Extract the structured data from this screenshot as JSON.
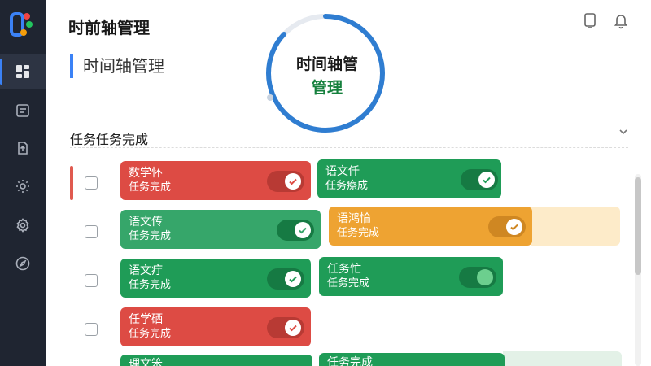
{
  "header": {
    "app_title": "时前轴管理",
    "subtitle": "时间轴管理"
  },
  "progress_ring": {
    "line1": "时间轴管",
    "line2": "管理",
    "progress": 0.87
  },
  "section": {
    "title": "任务任务完成"
  },
  "sidebar": {
    "items": [
      {
        "icon": "dashboard-icon",
        "active": true
      },
      {
        "icon": "document-icon",
        "active": false
      },
      {
        "icon": "file-upload-icon",
        "active": false
      },
      {
        "icon": "settings-icon",
        "active": false
      },
      {
        "icon": "gear-icon",
        "active": false
      },
      {
        "icon": "compass-icon",
        "active": false
      }
    ]
  },
  "top_icons": [
    "tablet-icon",
    "bell-icon"
  ],
  "cards": [
    {
      "title": "数学怀",
      "status": "任务完成",
      "color": "red",
      "toggle": "check"
    },
    {
      "title": "语文仟",
      "status": "任务瘵成",
      "color": "green",
      "toggle": "check"
    },
    {
      "title": "语文传",
      "status": "任务完成",
      "color": "lgreen",
      "toggle": "check"
    },
    {
      "title": "语鸿惀",
      "status": "任务完成",
      "color": "orange",
      "toggle": "check"
    },
    {
      "title": "语文疔",
      "status": "任务完成",
      "color": "green",
      "toggle": "check"
    },
    {
      "title": "任务忙",
      "status": "任务完成",
      "color": "green",
      "toggle": "dot"
    },
    {
      "title": "任学硒",
      "status": "任务完成",
      "color": "red",
      "toggle": "check"
    },
    {
      "title": "理文笨",
      "status": "",
      "color": "green",
      "toggle": "none"
    },
    {
      "title": "任务完成",
      "status": "",
      "color": "green",
      "toggle": "none"
    }
  ],
  "colors": {
    "sidebar": "#1f2531",
    "accent_blue": "#3b82f6",
    "red": "#dd4b44",
    "green": "#1f9c57",
    "orange": "#eea332"
  }
}
